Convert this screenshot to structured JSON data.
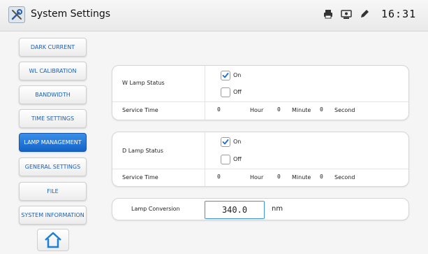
{
  "header": {
    "title": "System Settings",
    "time": "16:31",
    "status_icons": [
      "printer-icon",
      "monitor-icon",
      "pencil-icon"
    ]
  },
  "sidebar": {
    "items": [
      {
        "label": "DARK CURRENT",
        "active": false
      },
      {
        "label": "WL CALIBRATION",
        "active": false
      },
      {
        "label": "BANDWIDTH",
        "active": false
      },
      {
        "label": "TIME SETTINGS",
        "active": false
      },
      {
        "label": "LAMP MANAGEMENT",
        "active": true
      },
      {
        "label": "GENERAL SETTINGS",
        "active": false
      },
      {
        "label": "FILE",
        "active": false
      },
      {
        "label": "SYSTEM INFORMATION",
        "active": false
      }
    ],
    "home_icon": "home-icon"
  },
  "w_lamp": {
    "status_label": "W Lamp Status",
    "on_label": "On",
    "on_checked": true,
    "off_label": "Off",
    "off_checked": false,
    "service_label": "Service Time",
    "hours": "0",
    "hour_label": "Hour",
    "minutes": "0",
    "minute_label": "Minute",
    "seconds": "0",
    "second_label": "Second"
  },
  "d_lamp": {
    "status_label": "D Lamp Status",
    "on_label": "On",
    "on_checked": true,
    "off_label": "Off",
    "off_checked": false,
    "service_label": "Service Time",
    "hours": "0",
    "hour_label": "Hour",
    "minutes": "0",
    "minute_label": "Minute",
    "seconds": "0",
    "second_label": "Second"
  },
  "conversion": {
    "label": "Lamp Conversion",
    "value": "340.0",
    "unit": "nm"
  },
  "colors": {
    "accent": "#1a6fd6",
    "nav_text": "#1a5fb4"
  }
}
